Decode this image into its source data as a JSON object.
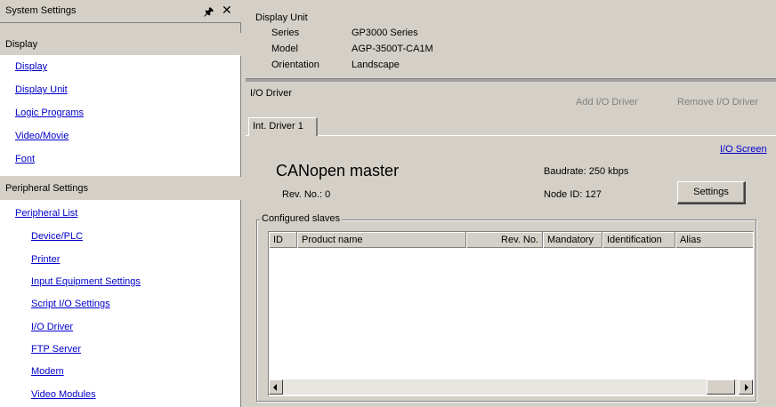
{
  "left_panel": {
    "title": "System Settings",
    "pin_glyph": "p",
    "close_glyph": "✕",
    "display_section": {
      "header": "Display",
      "items": [
        "Display",
        "Display Unit",
        "Logic Programs",
        "Video/Movie",
        "Font"
      ]
    },
    "peripheral_section": {
      "header": "Peripheral Settings",
      "list_label": "Peripheral List",
      "items": [
        "Device/PLC",
        "Printer",
        "Input Equipment Settings",
        "Script I/O Settings",
        "I/O Driver",
        "FTP Server",
        "Modem",
        "Video Modules"
      ]
    }
  },
  "display_unit": {
    "title": "Display Unit",
    "series_label": "Series",
    "series_value": "GP3000 Series",
    "model_label": "Model",
    "model_value": "AGP-3500T-CA1M",
    "orientation_label": "Orientation",
    "orientation_value": "Landscape"
  },
  "io_driver": {
    "label": "I/O Driver",
    "add_button": "Add I/O Driver",
    "remove_button": "Remove I/O Driver",
    "tab_label": "Int. Driver 1",
    "io_screen_link": "I/O Screen",
    "canopen_title": "CANopen master",
    "baudrate": "Baudrate: 250 kbps",
    "rev_no": "Rev. No.: 0",
    "node_id": "Node ID: 127",
    "settings_button": "Settings",
    "slaves_legend": "Configured slaves",
    "columns": [
      "ID",
      "Product name",
      "Rev. No.",
      "Mandatory",
      "Identification",
      "Alias"
    ]
  },
  "icons": {
    "pin": "pin-icon",
    "close": "close-icon",
    "scroll_left": "arrow-left-icon",
    "scroll_right": "arrow-right-icon"
  },
  "colors": {
    "link": "#0000cc",
    "panel": "#d4d0c8",
    "disabled": "#808080"
  }
}
